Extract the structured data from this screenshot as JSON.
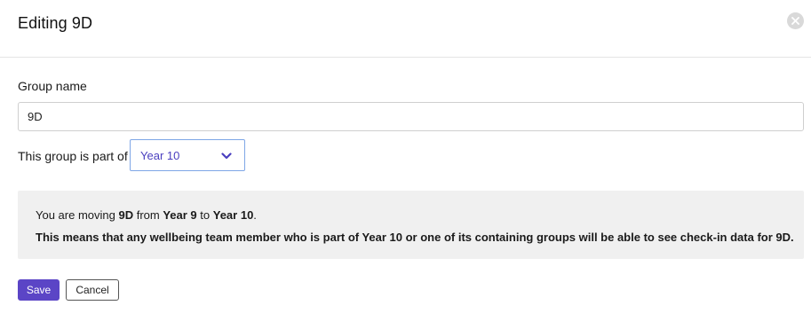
{
  "modal": {
    "title": "Editing 9D",
    "close_icon": "close-circle-icon"
  },
  "form": {
    "group_name_label": "Group name",
    "group_name_value": "9D",
    "part_of_label": "This group is part of",
    "parent_group_selected": "Year 10",
    "dropdown_icon": "chevron-down-icon"
  },
  "notice": {
    "line1": {
      "prefix": "You are moving ",
      "group": "9D",
      "from_text": " from ",
      "from_group": "Year 9",
      "to_text": " to ",
      "to_group": "Year 10",
      "suffix": "."
    },
    "line2": "This means that any wellbeing team member who is part of Year 10 or one of its containing groups will be able to see check-in data for 9D."
  },
  "actions": {
    "save_label": "Save",
    "cancel_label": "Cancel"
  },
  "colors": {
    "primary": "#5b45c6",
    "select_text": "#4a3fbf",
    "select_border": "#7ea6e6",
    "notice_bg": "#f0f0f0"
  }
}
